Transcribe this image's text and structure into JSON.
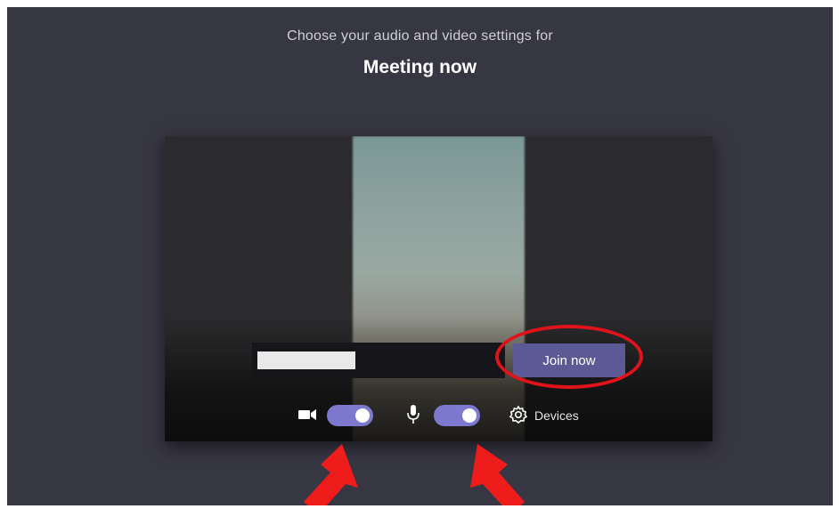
{
  "header": {
    "prompt": "Choose your audio and video settings for",
    "meeting_title": "Meeting now"
  },
  "preview": {
    "name_input_value": "",
    "join_label": "Join now",
    "devices_label": "Devices",
    "camera": {
      "icon": "camera-icon",
      "state": "on"
    },
    "microphone": {
      "icon": "mic-icon",
      "state": "on"
    },
    "settings_icon": "gear-icon"
  },
  "annotations": {
    "highlight_color": "#e0121a",
    "highlight_target": "join-button",
    "arrow_targets": [
      "camera-toggle",
      "mic-toggle"
    ]
  },
  "colors": {
    "background": "#373643",
    "toggle_on": "#7c79cf",
    "join_button": "#5c5a94"
  }
}
